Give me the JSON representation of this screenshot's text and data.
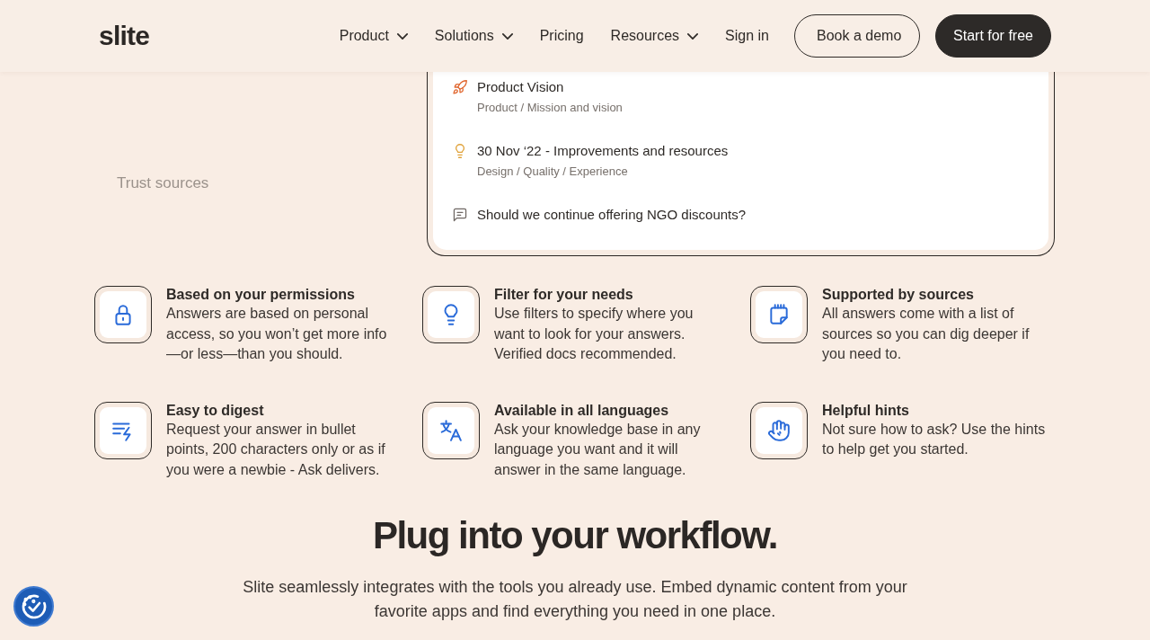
{
  "header": {
    "logo": "slite",
    "nav": [
      {
        "label": "Product",
        "menu": true
      },
      {
        "label": "Solutions",
        "menu": true
      },
      {
        "label": "Pricing",
        "menu": false
      },
      {
        "label": "Resources",
        "menu": true
      },
      {
        "label": "Sign in",
        "menu": false
      }
    ],
    "buttons": [
      {
        "label": "Book a demo",
        "kind": "outline"
      },
      {
        "label": "Start for free",
        "kind": "filled"
      }
    ]
  },
  "sidebar": {
    "items": [
      {
        "label": "Trust sources",
        "selected": false
      }
    ]
  },
  "results": [
    {
      "title": "Product Vision",
      "path": "Product / Mission and vision"
    },
    {
      "title": "30 Nov ‘22 - Improvements and resources",
      "path": "Design / Quality / Experience"
    },
    {
      "title": "Should we continue offering NGO discounts?"
    }
  ],
  "features": [
    {
      "title": "Based on your permissions",
      "text": "Answers are based on personal access, so you won’t get more info —or less—than you should."
    },
    {
      "title": "Filter for your needs",
      "text": "Use filters to specify where you want to look for your answers. Verified docs recommended."
    },
    {
      "title": "Supported by sources",
      "text": "All answers come with a list of sources so you can dig deeper if you need to."
    },
    {
      "title": "Easy to digest",
      "text": "Request your answer in bullet points, 200 characters only or as if you were a newbie - Ask delivers."
    },
    {
      "title": "Available in all languages",
      "text": "Ask your knowledge base in any language you want and it will answer in the same language."
    },
    {
      "title": "Helpful hints",
      "text": "Not sure how to ask? Use the hints to help get you started."
    }
  ],
  "workflow": {
    "heading": "Plug into your workflow.",
    "text": "Slite seamlessly integrates with the tools you already use. Embed dynamic content from your favorite apps and find everything you need in one place."
  }
}
